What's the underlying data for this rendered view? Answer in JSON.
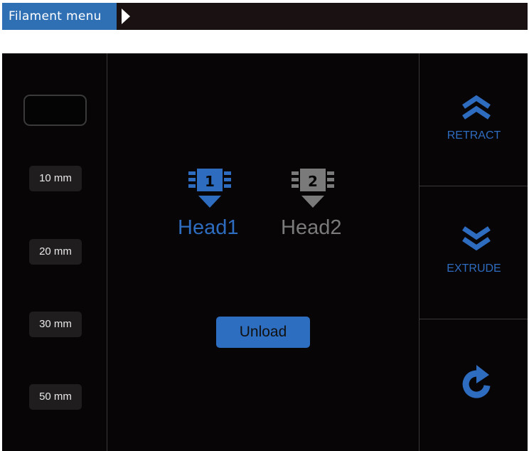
{
  "header": {
    "title": "Filament menu"
  },
  "distance_buttons": [
    {
      "label": "10 mm"
    },
    {
      "label": "20 mm"
    },
    {
      "label": "30 mm"
    },
    {
      "label": "50 mm"
    }
  ],
  "heads": [
    {
      "number": "1",
      "label": "Head1",
      "selected": true,
      "color": "#2e6cc0"
    },
    {
      "number": "2",
      "label": "Head2",
      "selected": false,
      "color": "#7a7a7a"
    }
  ],
  "unload": {
    "label": "Unload"
  },
  "actions": {
    "retract_label": "RETRACT",
    "extrude_label": "EXTRUDE",
    "retract_icon": "double-chevron-up-icon",
    "extrude_icon": "double-chevron-down-icon",
    "reset_icon": "refresh-icon"
  },
  "colors": {
    "accent": "#2e6cc0",
    "title_tab": "#2f6fb4",
    "panel_bg": "#070505"
  }
}
